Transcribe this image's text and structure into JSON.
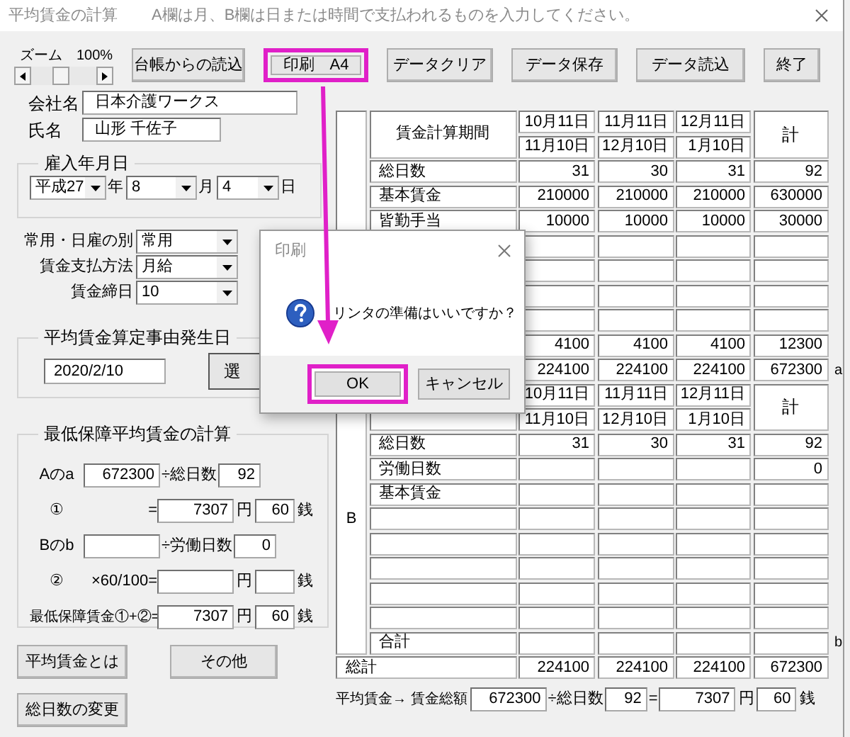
{
  "window": {
    "title": "平均賃金の計算",
    "hint": "A欄は月、B欄は日または時間で支払われるものを入力してください。"
  },
  "zoom": {
    "label": "ズーム",
    "value": "100%",
    "level": 0.45
  },
  "toolbar": [
    {
      "label": "台帳からの読込",
      "highlighted": false
    },
    {
      "label": "印刷　A4",
      "highlighted": true
    },
    {
      "label": "データクリア",
      "highlighted": false
    },
    {
      "label": "データ保存",
      "highlighted": false
    },
    {
      "label": "データ読込",
      "highlighted": false
    },
    {
      "label": "終了",
      "highlighted": false
    }
  ],
  "company": {
    "label": "会社名",
    "value": "日本介護ワークス"
  },
  "employee": {
    "label": "氏名",
    "value": "山形 千佐子"
  },
  "hire_date": {
    "title": "雇入年月日",
    "fields": [
      {
        "value": "平成27",
        "unit": "年"
      },
      {
        "value": "8",
        "unit": "月"
      },
      {
        "value": "4",
        "unit": "日"
      }
    ]
  },
  "settings": [
    {
      "label": "常用・日雇の別",
      "value": "常用"
    },
    {
      "label": "賃金支払方法",
      "value": "月給"
    },
    {
      "label": "賃金締日",
      "value": "10"
    }
  ],
  "occurrence": {
    "title": "平均賃金算定事由発生日",
    "date": "2020/2/10",
    "button": "選"
  },
  "minimum": {
    "title": "最低保障平均賃金の計算",
    "lines": [
      {
        "items": [
          {
            "kind": "label",
            "text": "Aのa"
          },
          {
            "kind": "amount",
            "text": "672300"
          },
          {
            "kind": "text",
            "text": "÷総日数"
          },
          {
            "kind": "count",
            "text": "92"
          }
        ]
      },
      {
        "items": [
          {
            "kind": "label",
            "text": "①"
          },
          {
            "kind": "eq",
            "text": "="
          },
          {
            "kind": "amount",
            "text": "7307"
          },
          {
            "kind": "unit",
            "text": "円"
          },
          {
            "kind": "sen",
            "text": "60"
          },
          {
            "kind": "unit",
            "text": "銭"
          }
        ]
      },
      {
        "items": [
          {
            "kind": "label",
            "text": "Bのb"
          },
          {
            "kind": "amount"
          },
          {
            "kind": "text",
            "text": "÷労働日数"
          },
          {
            "kind": "count",
            "text": "0"
          }
        ]
      },
      {
        "items": [
          {
            "kind": "label",
            "text": "②"
          },
          {
            "kind": "eq",
            "text": "×60/100="
          },
          {
            "kind": "amount"
          },
          {
            "kind": "unit",
            "text": "円"
          },
          {
            "kind": "sen"
          },
          {
            "kind": "unit",
            "text": "銭"
          }
        ]
      },
      {
        "items": [
          {
            "kind": "wide",
            "text": "最低保障賃金①+②="
          },
          {
            "kind": "amount",
            "text": "7307"
          },
          {
            "kind": "unit",
            "text": "円"
          },
          {
            "kind": "sen",
            "text": "60"
          },
          {
            "kind": "unit",
            "text": "銭"
          }
        ]
      }
    ]
  },
  "buttons": [
    {
      "label": "平均賃金とは"
    },
    {
      "label": "その他"
    },
    {
      "label": "総日数の変更"
    }
  ],
  "table_a": {
    "header": {
      "label": "賃金計算期間",
      "periods": [
        [
          "10月11日",
          "11月10日"
        ],
        [
          "11月11日",
          "12月10日"
        ],
        [
          "12月11日",
          "1月10日"
        ]
      ],
      "total": "計"
    },
    "rows": [
      {
        "label": "総日数",
        "values": [
          "31",
          "30",
          "31",
          "92"
        ]
      },
      {
        "label": "基本賃金",
        "values": [
          "210000",
          "210000",
          "210000",
          "630000"
        ]
      },
      {
        "label": "皆勤手当",
        "values": [
          "10000",
          "10000",
          "10000",
          "30000"
        ]
      },
      {},
      {},
      {},
      {},
      {
        "values": [
          "4100",
          "4100",
          "4100",
          "12300"
        ]
      },
      {
        "values": [
          "224100",
          "224100",
          "224100",
          "672300"
        ],
        "mark": "a"
      }
    ]
  },
  "table_b": {
    "side_label": "B",
    "header": {
      "periods": [
        [
          "10月11日",
          "11月10日"
        ],
        [
          "11月11日",
          "12月10日"
        ],
        [
          "12月11日",
          "1月10日"
        ]
      ],
      "total": "計"
    },
    "rows": [
      {
        "label": "総日数",
        "values": [
          "31",
          "30",
          "31",
          "92"
        ]
      },
      {
        "label": "労働日数",
        "total": "0"
      },
      {
        "label": "基本賃金"
      },
      {},
      {},
      {},
      {},
      {},
      {
        "label": "合計",
        "mark": "b"
      }
    ]
  },
  "grand_total": {
    "label": "総計",
    "values": [
      "224100",
      "224100",
      "224100",
      "672300"
    ]
  },
  "average": [
    {
      "kind": "caption",
      "text": "平均賃金→ 賃金総額"
    },
    {
      "kind": "amount",
      "text": "672300"
    },
    {
      "kind": "text",
      "text": "÷総日数"
    },
    {
      "kind": "count",
      "text": "92"
    },
    {
      "kind": "text",
      "text": "="
    },
    {
      "kind": "amount",
      "text": "7307"
    },
    {
      "kind": "unit",
      "text": "円"
    },
    {
      "kind": "sen",
      "text": "60"
    },
    {
      "kind": "unit",
      "text": "銭"
    }
  ],
  "dialog": {
    "title": "印刷",
    "message": "リンタの準備はいいですか？",
    "buttons": [
      {
        "label": "OK",
        "highlighted": true
      },
      {
        "label": "キャンセル",
        "highlighted": false
      }
    ]
  }
}
